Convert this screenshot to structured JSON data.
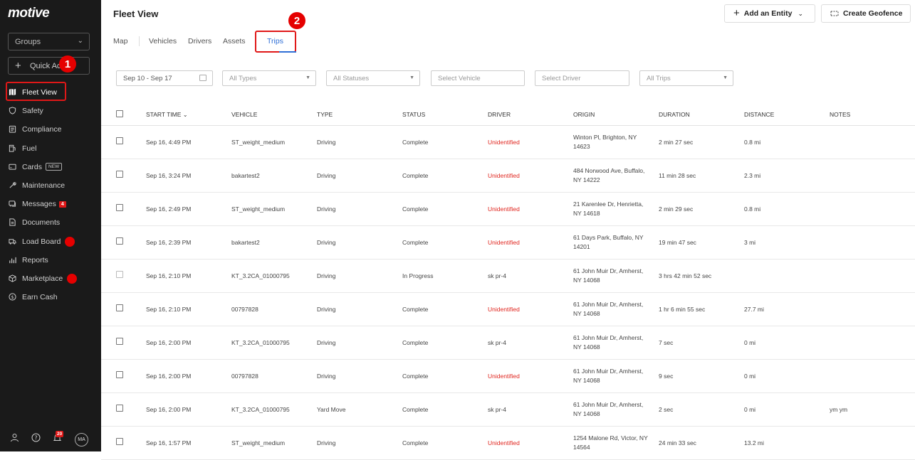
{
  "sidebar": {
    "logo": "motive",
    "groups_label": "Groups",
    "quick_action_label": "Quick Ac",
    "items": [
      {
        "label": "Fleet View",
        "icon": "map-icon"
      },
      {
        "label": "Safety",
        "icon": "shield-icon"
      },
      {
        "label": "Compliance",
        "icon": "clipboard-icon"
      },
      {
        "label": "Fuel",
        "icon": "fuel-icon"
      },
      {
        "label": "Cards",
        "icon": "card-icon",
        "tag": "NEW"
      },
      {
        "label": "Maintenance",
        "icon": "wrench-icon"
      },
      {
        "label": "Messages",
        "icon": "message-icon",
        "count": "4"
      },
      {
        "label": "Documents",
        "icon": "document-icon"
      },
      {
        "label": "Load Board",
        "icon": "truck-icon",
        "dot": true
      },
      {
        "label": "Reports",
        "icon": "chart-icon"
      },
      {
        "label": "Marketplace",
        "icon": "cube-icon",
        "dot": true
      },
      {
        "label": "Earn Cash",
        "icon": "dollar-icon"
      }
    ],
    "bottom": {
      "notification_count": "20",
      "avatar_initials": "MA"
    }
  },
  "callouts": {
    "one": "1",
    "two": "2"
  },
  "header": {
    "title": "Fleet View",
    "add_entity_label": "Add an Entity",
    "create_geofence_label": "Create Geofence"
  },
  "tabs": [
    "Map",
    "Vehicles",
    "Drivers",
    "Assets",
    "Trips"
  ],
  "active_tab": "Trips",
  "filters": {
    "date_range": "Sep 10 - Sep 17",
    "types": "All Types",
    "statuses": "All Statuses",
    "vehicle": "Select Vehicle",
    "driver": "Select Driver",
    "trips": "All Trips"
  },
  "table": {
    "columns": [
      "START TIME",
      "VEHICLE",
      "TYPE",
      "STATUS",
      "DRIVER",
      "ORIGIN",
      "DURATION",
      "DISTANCE",
      "NOTES"
    ],
    "rows": [
      {
        "start": "Sep 16, 4:49 PM",
        "vehicle": "ST_weight_medium",
        "type": "Driving",
        "status": "Complete",
        "driver": "Unidentified",
        "origin1": "Winton Pl, Brighton, NY",
        "origin2": "14623",
        "duration": "2 min 27 sec",
        "distance": "0.8 mi",
        "notes": ""
      },
      {
        "start": "Sep 16, 3:24 PM",
        "vehicle": "bakartest2",
        "type": "Driving",
        "status": "Complete",
        "driver": "Unidentified",
        "origin1": "484 Norwood Ave, Buffalo,",
        "origin2": "NY 14222",
        "duration": "11 min 28 sec",
        "distance": "2.3 mi",
        "notes": ""
      },
      {
        "start": "Sep 16, 2:49 PM",
        "vehicle": "ST_weight_medium",
        "type": "Driving",
        "status": "Complete",
        "driver": "Unidentified",
        "origin1": "21 Karenlee Dr, Henrietta,",
        "origin2": "NY 14618",
        "duration": "2 min 29 sec",
        "distance": "0.8 mi",
        "notes": ""
      },
      {
        "start": "Sep 16, 2:39 PM",
        "vehicle": "bakartest2",
        "type": "Driving",
        "status": "Complete",
        "driver": "Unidentified",
        "origin1": "61 Days Park, Buffalo, NY",
        "origin2": "14201",
        "duration": "19 min 47 sec",
        "distance": "3 mi",
        "notes": ""
      },
      {
        "start": "Sep 16, 2:10 PM",
        "vehicle": "KT_3.2CA_01000795",
        "type": "Driving",
        "status": "In Progress",
        "driver": "sk pr-4",
        "origin1": "61 John Muir Dr, Amherst,",
        "origin2": "NY 14068",
        "duration": "3 hrs 42 min 52 sec",
        "distance": "",
        "notes": ""
      },
      {
        "start": "Sep 16, 2:10 PM",
        "vehicle": "00797828",
        "type": "Driving",
        "status": "Complete",
        "driver": "Unidentified",
        "origin1": "61 John Muir Dr, Amherst,",
        "origin2": "NY 14068",
        "duration": "1 hr 6 min 55 sec",
        "distance": "27.7 mi",
        "notes": ""
      },
      {
        "start": "Sep 16, 2:00 PM",
        "vehicle": "KT_3.2CA_01000795",
        "type": "Driving",
        "status": "Complete",
        "driver": "sk pr-4",
        "origin1": "61 John Muir Dr, Amherst,",
        "origin2": "NY 14068",
        "duration": "7 sec",
        "distance": "0 mi",
        "notes": ""
      },
      {
        "start": "Sep 16, 2:00 PM",
        "vehicle": "00797828",
        "type": "Driving",
        "status": "Complete",
        "driver": "Unidentified",
        "origin1": "61 John Muir Dr, Amherst,",
        "origin2": "NY 14068",
        "duration": "9 sec",
        "distance": "0 mi",
        "notes": ""
      },
      {
        "start": "Sep 16, 2:00 PM",
        "vehicle": "KT_3.2CA_01000795",
        "type": "Yard Move",
        "status": "Complete",
        "driver": "sk pr-4",
        "origin1": "61 John Muir Dr, Amherst,",
        "origin2": "NY 14068",
        "duration": "2 sec",
        "distance": "0 mi",
        "notes": "ym ym"
      },
      {
        "start": "Sep 16, 1:57 PM",
        "vehicle": "ST_weight_medium",
        "type": "Driving",
        "status": "Complete",
        "driver": "Unidentified",
        "origin1": "1254 Malone Rd, Victor, NY",
        "origin2": "14564",
        "duration": "24 min 33 sec",
        "distance": "13.2 mi",
        "notes": ""
      }
    ]
  }
}
